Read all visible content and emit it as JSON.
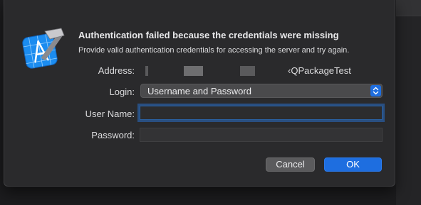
{
  "dialog": {
    "title": "Authentication failed because the credentials were missing",
    "subtitle": "Provide valid authentication credentials for accessing the server and try again.",
    "app_icon": "xcode-hammer-icon"
  },
  "form": {
    "address_label": "Address:",
    "address_value": "‹QPackageTest",
    "login_label": "Login:",
    "login_selected": "Username and Password",
    "username_label": "User Name:",
    "username_value": "",
    "password_label": "Password:",
    "password_value": ""
  },
  "buttons": {
    "cancel_label": "Cancel",
    "ok_label": "OK"
  },
  "colors": {
    "accent": "#1e6ee0",
    "dialog_bg": "#2a2a2c",
    "text": "#dcdcde"
  }
}
